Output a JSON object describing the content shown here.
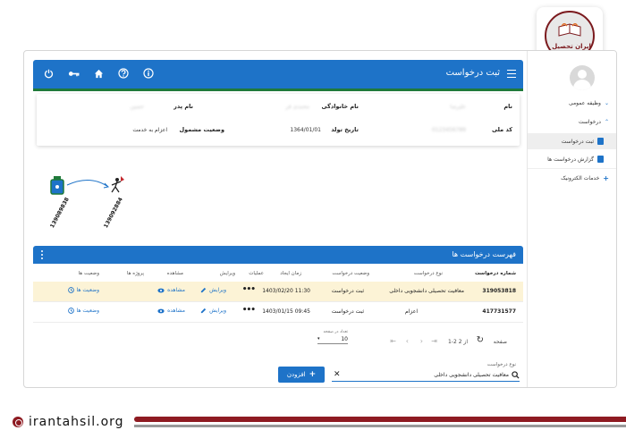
{
  "brand": {
    "logo_text": "ایران تحصیل",
    "site_url": "irantahsil.org"
  },
  "sidebar": {
    "items": [
      {
        "label": "وظیفه عمومی",
        "expanded": false
      },
      {
        "label": "درخواست",
        "expanded": true
      },
      {
        "label": "ثبت درخواست",
        "sub": true,
        "active": true
      },
      {
        "label": "گزارش درخواست ها",
        "sub": true,
        "active": false
      },
      {
        "label": "خدمات الکترونیک",
        "expandable": true
      }
    ]
  },
  "header": {
    "title": "ثبت درخواست",
    "icons": [
      "power-icon",
      "key-icon",
      "home-icon",
      "help-icon",
      "info-icon"
    ]
  },
  "profile": {
    "name_label": "نام",
    "name_value": "علیرضا",
    "family_label": "نام خانوادگی",
    "family_value": "محمدی فر",
    "father_label": "نام پدر",
    "father_value": "حسین",
    "national_code_label": "کد ملی",
    "national_code_value": "0123456789",
    "birth_label": "تاریخ تولد",
    "birth_value": "1364/01/01",
    "status_label": "وضعیت مشمول",
    "status_value": "اعزام به خدمت"
  },
  "diagram": {
    "labels": [
      "139089838",
      "139092884"
    ]
  },
  "requests": {
    "title": "فهرست درخواست ها",
    "columns": {
      "number": "شماره درخواست",
      "type": "نوع درخواست",
      "status": "وضعیت درخواست",
      "created": "زمان ایجاد",
      "ops": "عملیات",
      "edit": "ویرایش",
      "view": "مشاهده",
      "project": "پروژه ها",
      "states": "وضعیت ها"
    },
    "rows": [
      {
        "number": "319053818",
        "type": "معافیت تحصیلی دانشجویی داخلی",
        "status": "ثبت درخواست",
        "created": "1403/02/20 11:30",
        "highlight": true
      },
      {
        "number": "417731577",
        "type": "اعزام",
        "status": "ثبت درخواست",
        "created": "1403/01/15 09:45",
        "highlight": false
      }
    ],
    "actions": {
      "edit": "ویرایش",
      "view": "مشاهده",
      "states": "وضعیت ها",
      "more": "•••"
    },
    "pager": {
      "label": "صفحه",
      "range": "1-2 از 2",
      "per_page_label": "تعداد در صفحه",
      "per_page_value": "10"
    }
  },
  "filter": {
    "label": "نوع درخواست",
    "value": "معافیت تحصیلی دانشجویی داخلی",
    "add_label": "افزودن"
  },
  "colors": {
    "primary": "#1e73c8",
    "accent_green": "#1f7a3a",
    "highlight_row": "#fcf3d6",
    "brand_red": "#8e1b22"
  }
}
